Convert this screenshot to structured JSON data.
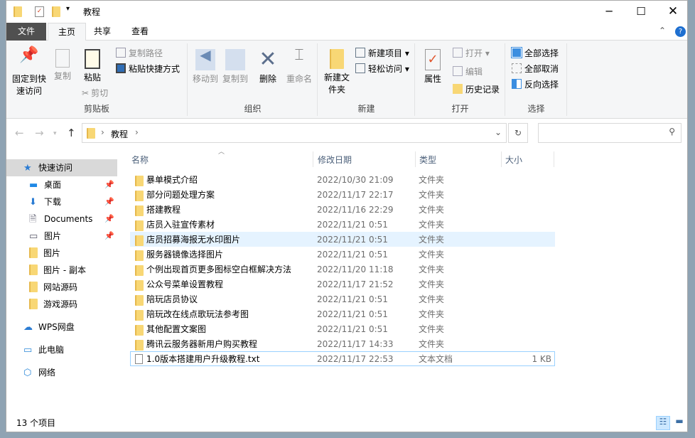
{
  "window": {
    "title": "教程"
  },
  "tabs": {
    "file": "文件",
    "home": "主页",
    "share": "共享",
    "view": "查看"
  },
  "ribbon": {
    "clipboard": {
      "pin": "固定到快速访问",
      "copy": "复制",
      "paste": "粘贴",
      "copy_path": "复制路径",
      "paste_shortcut": "粘贴快捷方式",
      "cut": "剪切",
      "label": "剪贴板"
    },
    "organize": {
      "move_to": "移动到",
      "copy_to": "复制到",
      "delete": "删除",
      "rename": "重命名",
      "label": "组织"
    },
    "new": {
      "new_folder": "新建文件夹",
      "new_item": "新建项目",
      "easy_access": "轻松访问",
      "label": "新建"
    },
    "open": {
      "properties": "属性",
      "open": "打开",
      "edit": "编辑",
      "history": "历史记录",
      "label": "打开"
    },
    "select": {
      "select_all": "全部选择",
      "select_none": "全部取消",
      "invert": "反向选择",
      "label": "选择"
    }
  },
  "address": {
    "crumb": "教程",
    "search_placeholder": ""
  },
  "sidebar": {
    "items": [
      {
        "label": "快速访问",
        "icon": "star-icon"
      },
      {
        "label": "桌面",
        "icon": "desktop-icon",
        "pinned": true
      },
      {
        "label": "下载",
        "icon": "download-icon",
        "pinned": true
      },
      {
        "label": "Documents",
        "icon": "document-icon",
        "pinned": true
      },
      {
        "label": "图片",
        "icon": "pictures-icon",
        "pinned": true
      },
      {
        "label": "图片",
        "icon": "folder-icon"
      },
      {
        "label": "图片 - 副本",
        "icon": "folder-icon"
      },
      {
        "label": "网站源码",
        "icon": "folder-icon"
      },
      {
        "label": "游戏源码",
        "icon": "folder-icon"
      },
      {
        "label": "WPS网盘",
        "icon": "cloud-icon"
      },
      {
        "label": "此电脑",
        "icon": "computer-icon"
      },
      {
        "label": "网络",
        "icon": "network-icon"
      }
    ]
  },
  "columns": {
    "name": "名称",
    "date": "修改日期",
    "type": "类型",
    "size": "大小"
  },
  "files": [
    {
      "name": "暴单模式介绍",
      "date": "2022/10/30 21:09",
      "type": "文件夹",
      "size": ""
    },
    {
      "name": "部分问题处理方案",
      "date": "2022/11/17 22:17",
      "type": "文件夹",
      "size": ""
    },
    {
      "name": "搭建教程",
      "date": "2022/11/16 22:29",
      "type": "文件夹",
      "size": ""
    },
    {
      "name": "店员入驻宣传素材",
      "date": "2022/11/21 0:51",
      "type": "文件夹",
      "size": ""
    },
    {
      "name": "店员招募海报无水印图片",
      "date": "2022/11/21 0:51",
      "type": "文件夹",
      "size": ""
    },
    {
      "name": "服务器镜像选择图片",
      "date": "2022/11/21 0:51",
      "type": "文件夹",
      "size": ""
    },
    {
      "name": "个例出现首页更多图标空白框解决方法",
      "date": "2022/11/20 11:18",
      "type": "文件夹",
      "size": ""
    },
    {
      "name": "公众号菜单设置教程",
      "date": "2022/11/17 21:52",
      "type": "文件夹",
      "size": ""
    },
    {
      "name": "陪玩店员协议",
      "date": "2022/11/21 0:51",
      "type": "文件夹",
      "size": ""
    },
    {
      "name": "陪玩改在线点歌玩法参考图",
      "date": "2022/11/21 0:51",
      "type": "文件夹",
      "size": ""
    },
    {
      "name": "其他配置文案图",
      "date": "2022/11/21 0:51",
      "type": "文件夹",
      "size": ""
    },
    {
      "name": "腾讯云服务器新用户购买教程",
      "date": "2022/11/17 14:33",
      "type": "文件夹",
      "size": ""
    },
    {
      "name": "1.0版本搭建用户升级教程.txt",
      "date": "2022/11/17 22:53",
      "type": "文本文档",
      "size": "1 KB"
    }
  ],
  "status": {
    "count": "13 个项目"
  }
}
